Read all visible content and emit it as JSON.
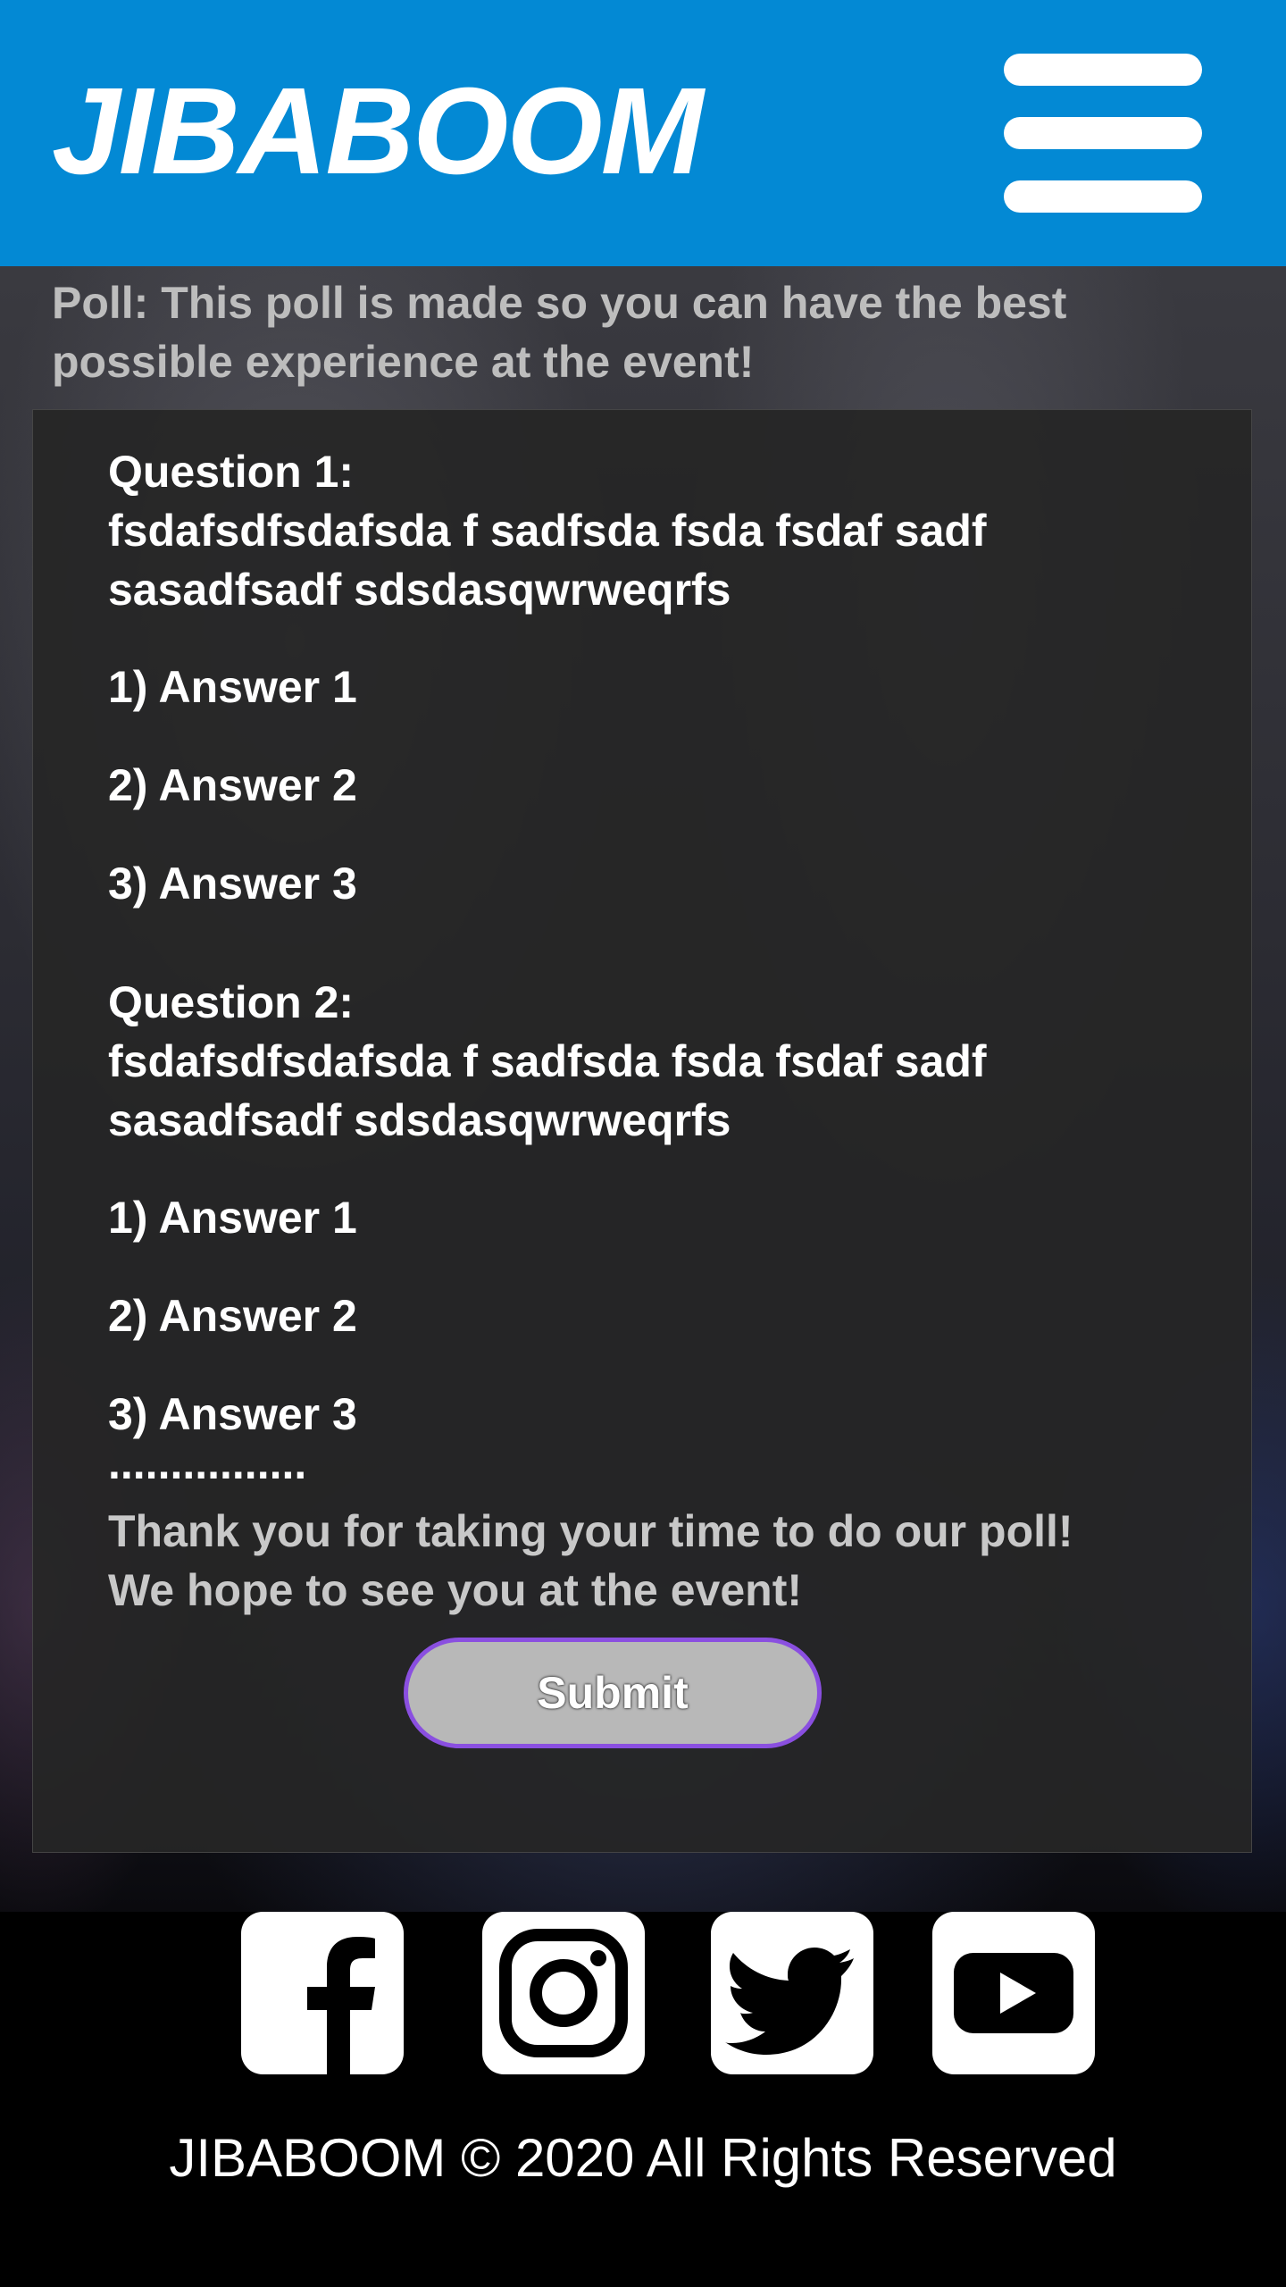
{
  "header": {
    "logo": "JIBABOOM",
    "menu_icon": "hamburger-menu-icon"
  },
  "poll": {
    "intro": "Poll: This poll is made so you can have the best\n possible experience at the event!",
    "questions": [
      {
        "label": "Question 1:",
        "text_line1": "fsdafsdfsdafsda f sadfsda fsda fsdaf sadf",
        "text_line2": "sasadfsadf sdsdasqwrweqrfs",
        "answers": [
          "1) Answer 1",
          "2) Answer 2",
          "3) Answer 3"
        ]
      },
      {
        "label": "Question 2:",
        "text_line1": "fsdafsdfsdafsda f sadfsda fsda fsdaf sadf",
        "text_line2": "sasadfsadf sdsdasqwrweqrfs",
        "answers": [
          "1) Answer 1",
          "2) Answer 2",
          "3) Answer 3"
        ]
      }
    ],
    "ellipsis": "................",
    "thanks_line1": "Thank you for taking your time to do our poll!",
    "thanks_line2": "We hope to see you at the event!",
    "submit_label": "Submit"
  },
  "footer": {
    "social": [
      {
        "name": "facebook-icon"
      },
      {
        "name": "instagram-icon"
      },
      {
        "name": "twitter-icon"
      },
      {
        "name": "youtube-icon"
      }
    ],
    "copyright": "JIBABOOM © 2020 All Rights Reserved"
  },
  "colors": {
    "header_bg": "#0389d4",
    "submit_border": "#8a4fe0",
    "submit_bg": "#b8b8b8",
    "card_bg": "#262626"
  }
}
